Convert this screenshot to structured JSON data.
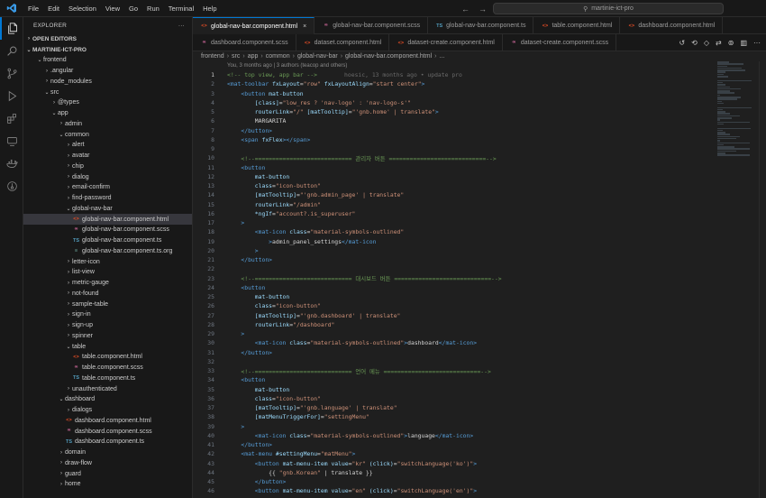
{
  "titlebar": {
    "menu": [
      "File",
      "Edit",
      "Selection",
      "View",
      "Go",
      "Run",
      "Terminal",
      "Help"
    ],
    "search": "martinie-ict-pro"
  },
  "sidebar": {
    "title": "EXPLORER",
    "open_editors": "OPEN EDITORS",
    "project": "MARTINIE-ICT-PRO",
    "tree": [
      {
        "label": "frontend",
        "depth": 1,
        "kind": "folder-open"
      },
      {
        "label": ".angular",
        "depth": 2,
        "kind": "folder"
      },
      {
        "label": "node_modules",
        "depth": 2,
        "kind": "folder"
      },
      {
        "label": "src",
        "depth": 2,
        "kind": "folder-open"
      },
      {
        "label": "@types",
        "depth": 3,
        "kind": "folder"
      },
      {
        "label": "app",
        "depth": 3,
        "kind": "folder-open"
      },
      {
        "label": "admin",
        "depth": 4,
        "kind": "folder"
      },
      {
        "label": "common",
        "depth": 4,
        "kind": "folder-open"
      },
      {
        "label": "alert",
        "depth": 5,
        "kind": "folder"
      },
      {
        "label": "avatar",
        "depth": 5,
        "kind": "folder"
      },
      {
        "label": "chip",
        "depth": 5,
        "kind": "folder"
      },
      {
        "label": "dialog",
        "depth": 5,
        "kind": "folder"
      },
      {
        "label": "email-confirm",
        "depth": 5,
        "kind": "folder"
      },
      {
        "label": "find-password",
        "depth": 5,
        "kind": "folder"
      },
      {
        "label": "global-nav-bar",
        "depth": 5,
        "kind": "folder-open"
      },
      {
        "label": "global-nav-bar.component.html",
        "depth": 6,
        "kind": "html",
        "selected": true
      },
      {
        "label": "global-nav-bar.component.scss",
        "depth": 6,
        "kind": "scss"
      },
      {
        "label": "global-nav-bar.component.ts",
        "depth": 6,
        "kind": "ts"
      },
      {
        "label": "global-nav-bar.component.ts.org",
        "depth": 6,
        "kind": "org"
      },
      {
        "label": "letter-icon",
        "depth": 5,
        "kind": "folder"
      },
      {
        "label": "list-view",
        "depth": 5,
        "kind": "folder"
      },
      {
        "label": "metric-gauge",
        "depth": 5,
        "kind": "folder"
      },
      {
        "label": "not-found",
        "depth": 5,
        "kind": "folder"
      },
      {
        "label": "sample-table",
        "depth": 5,
        "kind": "folder"
      },
      {
        "label": "sign-in",
        "depth": 5,
        "kind": "folder"
      },
      {
        "label": "sign-up",
        "depth": 5,
        "kind": "folder"
      },
      {
        "label": "spinner",
        "depth": 5,
        "kind": "folder"
      },
      {
        "label": "table",
        "depth": 5,
        "kind": "folder-open"
      },
      {
        "label": "table.component.html",
        "depth": 6,
        "kind": "html"
      },
      {
        "label": "table.component.scss",
        "depth": 6,
        "kind": "scss"
      },
      {
        "label": "table.component.ts",
        "depth": 6,
        "kind": "ts"
      },
      {
        "label": "unauthenticated",
        "depth": 5,
        "kind": "folder"
      },
      {
        "label": "dashboard",
        "depth": 4,
        "kind": "folder-open"
      },
      {
        "label": "dialogs",
        "depth": 5,
        "kind": "folder"
      },
      {
        "label": "dashboard.component.html",
        "depth": 5,
        "kind": "html"
      },
      {
        "label": "dashboard.component.scss",
        "depth": 5,
        "kind": "scss"
      },
      {
        "label": "dashboard.component.ts",
        "depth": 5,
        "kind": "ts"
      },
      {
        "label": "domain",
        "depth": 4,
        "kind": "folder"
      },
      {
        "label": "draw-flow",
        "depth": 4,
        "kind": "folder"
      },
      {
        "label": "guard",
        "depth": 4,
        "kind": "folder"
      },
      {
        "label": "home",
        "depth": 4,
        "kind": "folder"
      }
    ]
  },
  "tabs": {
    "row1": [
      {
        "label": "global-nav-bar.component.html",
        "kind": "html",
        "active": true
      },
      {
        "label": "global-nav-bar.component.scss",
        "kind": "scss"
      },
      {
        "label": "global-nav-bar.component.ts",
        "kind": "ts"
      },
      {
        "label": "table.component.html",
        "kind": "html"
      },
      {
        "label": "dashboard.component.html",
        "kind": "html"
      }
    ],
    "row2": [
      {
        "label": "dashboard.component.scss",
        "kind": "scss"
      },
      {
        "label": "dataset.component.html",
        "kind": "html"
      },
      {
        "label": "dataset-create.component.html",
        "kind": "html"
      },
      {
        "label": "dataset-create.component.scss",
        "kind": "scss"
      }
    ]
  },
  "breadcrumb": [
    "frontend",
    "src",
    "app",
    "common",
    "global-nav-bar",
    "global-nav-bar.component.html",
    "..."
  ],
  "editor": {
    "blame_header": "You, 3 months ago | 3 authors (teacop and others)",
    "inline_blame": "hoesic, 13 months ago • update pro",
    "lines": [
      [
        [
          "c",
          "<!-- top view, app bar -->"
        ]
      ],
      [
        [
          "t",
          "<mat-toolbar "
        ],
        [
          "a",
          "fxLayout"
        ],
        [
          "x",
          "="
        ],
        [
          "s",
          "\"row\""
        ],
        [
          "x",
          " "
        ],
        [
          "a",
          "fxLayoutAlign"
        ],
        [
          "x",
          "="
        ],
        [
          "s",
          "\"start center\""
        ],
        [
          "t",
          ">"
        ]
      ],
      [
        [
          "x",
          "    "
        ],
        [
          "t",
          "<button "
        ],
        [
          "a",
          "mat-button"
        ]
      ],
      [
        [
          "x",
          "        "
        ],
        [
          "a",
          "[class]"
        ],
        [
          "x",
          "="
        ],
        [
          "s",
          "\"low_res ? 'nav-logo' : 'nav-logo-s'\""
        ]
      ],
      [
        [
          "x",
          "        "
        ],
        [
          "a",
          "routerLink"
        ],
        [
          "x",
          "="
        ],
        [
          "s",
          "\"/\""
        ],
        [
          "x",
          " "
        ],
        [
          "a",
          "[matTooltip]"
        ],
        [
          "x",
          "="
        ],
        [
          "s",
          "\"'gnb.home' | translate\""
        ],
        [
          "t",
          ">"
        ]
      ],
      [
        [
          "x",
          "        MARGARITA"
        ]
      ],
      [
        [
          "x",
          "    "
        ],
        [
          "t",
          "</button>"
        ]
      ],
      [
        [
          "x",
          "    "
        ],
        [
          "t",
          "<span "
        ],
        [
          "a",
          "fxFlex"
        ],
        [
          "t",
          "></span>"
        ]
      ],
      [
        [
          "x",
          ""
        ]
      ],
      [
        [
          "x",
          "    "
        ],
        [
          "c",
          "<!--============================ 관리자 버튼 ============================-->"
        ]
      ],
      [
        [
          "x",
          "    "
        ],
        [
          "t",
          "<button"
        ]
      ],
      [
        [
          "x",
          "        "
        ],
        [
          "a",
          "mat-button"
        ]
      ],
      [
        [
          "x",
          "        "
        ],
        [
          "a",
          "class"
        ],
        [
          "x",
          "="
        ],
        [
          "s",
          "\"icon-button\""
        ]
      ],
      [
        [
          "x",
          "        "
        ],
        [
          "a",
          "[matTooltip]"
        ],
        [
          "x",
          "="
        ],
        [
          "s",
          "\"'gnb.admin_page' | translate\""
        ]
      ],
      [
        [
          "x",
          "        "
        ],
        [
          "a",
          "routerLink"
        ],
        [
          "x",
          "="
        ],
        [
          "s",
          "\"/admin\""
        ]
      ],
      [
        [
          "x",
          "        "
        ],
        [
          "a",
          "*ngIf"
        ],
        [
          "x",
          "="
        ],
        [
          "s",
          "\"account?.is_superuser\""
        ]
      ],
      [
        [
          "x",
          "    "
        ],
        [
          "t",
          ">"
        ]
      ],
      [
        [
          "x",
          "        "
        ],
        [
          "t",
          "<mat-icon "
        ],
        [
          "a",
          "class"
        ],
        [
          "x",
          "="
        ],
        [
          "s",
          "\"material-symbols-outlined\""
        ]
      ],
      [
        [
          "x",
          "            "
        ],
        [
          "t",
          ">"
        ],
        [
          "x",
          "admin_panel_settings"
        ],
        [
          "t",
          "</mat-icon"
        ]
      ],
      [
        [
          "x",
          "        "
        ],
        [
          "t",
          ">"
        ]
      ],
      [
        [
          "x",
          "    "
        ],
        [
          "t",
          "</button>"
        ]
      ],
      [
        [
          "x",
          ""
        ]
      ],
      [
        [
          "x",
          "    "
        ],
        [
          "c",
          "<!--============================ 대시보드 버튼 ============================-->"
        ]
      ],
      [
        [
          "x",
          "    "
        ],
        [
          "t",
          "<button"
        ]
      ],
      [
        [
          "x",
          "        "
        ],
        [
          "a",
          "mat-button"
        ]
      ],
      [
        [
          "x",
          "        "
        ],
        [
          "a",
          "class"
        ],
        [
          "x",
          "="
        ],
        [
          "s",
          "\"icon-button\""
        ]
      ],
      [
        [
          "x",
          "        "
        ],
        [
          "a",
          "[matTooltip]"
        ],
        [
          "x",
          "="
        ],
        [
          "s",
          "\"'gnb.dashboard' | translate\""
        ]
      ],
      [
        [
          "x",
          "        "
        ],
        [
          "a",
          "routerLink"
        ],
        [
          "x",
          "="
        ],
        [
          "s",
          "\"/dashboard\""
        ]
      ],
      [
        [
          "x",
          "    "
        ],
        [
          "t",
          ">"
        ]
      ],
      [
        [
          "x",
          "        "
        ],
        [
          "t",
          "<mat-icon "
        ],
        [
          "a",
          "class"
        ],
        [
          "x",
          "="
        ],
        [
          "s",
          "\"material-symbols-outlined\""
        ],
        [
          "t",
          ">"
        ],
        [
          "x",
          "dashboard"
        ],
        [
          "t",
          "</mat-icon>"
        ]
      ],
      [
        [
          "x",
          "    "
        ],
        [
          "t",
          "</button>"
        ]
      ],
      [
        [
          "x",
          ""
        ]
      ],
      [
        [
          "x",
          "    "
        ],
        [
          "c",
          "<!--============================ 언어 메뉴 ============================-->"
        ]
      ],
      [
        [
          "x",
          "    "
        ],
        [
          "t",
          "<button"
        ]
      ],
      [
        [
          "x",
          "        "
        ],
        [
          "a",
          "mat-button"
        ]
      ],
      [
        [
          "x",
          "        "
        ],
        [
          "a",
          "class"
        ],
        [
          "x",
          "="
        ],
        [
          "s",
          "\"icon-button\""
        ]
      ],
      [
        [
          "x",
          "        "
        ],
        [
          "a",
          "[matTooltip]"
        ],
        [
          "x",
          "="
        ],
        [
          "s",
          "\"'gnb.language' | translate\""
        ]
      ],
      [
        [
          "x",
          "        "
        ],
        [
          "a",
          "[matMenuTriggerFor]"
        ],
        [
          "x",
          "="
        ],
        [
          "s",
          "\"settingMenu\""
        ]
      ],
      [
        [
          "x",
          "    "
        ],
        [
          "t",
          ">"
        ]
      ],
      [
        [
          "x",
          "        "
        ],
        [
          "t",
          "<mat-icon "
        ],
        [
          "a",
          "class"
        ],
        [
          "x",
          "="
        ],
        [
          "s",
          "\"material-symbols-outlined\""
        ],
        [
          "t",
          ">"
        ],
        [
          "x",
          "language"
        ],
        [
          "t",
          "</mat-icon>"
        ]
      ],
      [
        [
          "x",
          "    "
        ],
        [
          "t",
          "</button>"
        ]
      ],
      [
        [
          "x",
          "    "
        ],
        [
          "t",
          "<mat-menu "
        ],
        [
          "a",
          "#settingMenu"
        ],
        [
          "x",
          "="
        ],
        [
          "s",
          "\"matMenu\""
        ],
        [
          "t",
          ">"
        ]
      ],
      [
        [
          "x",
          "        "
        ],
        [
          "t",
          "<button "
        ],
        [
          "a",
          "mat-menu-item "
        ],
        [
          "a",
          "value"
        ],
        [
          "x",
          "="
        ],
        [
          "s",
          "\"kr\""
        ],
        [
          "x",
          " "
        ],
        [
          "a",
          "(click)"
        ],
        [
          "x",
          "="
        ],
        [
          "s",
          "\"switchLanguage('ko')\""
        ],
        [
          "t",
          ">"
        ]
      ],
      [
        [
          "x",
          "            {{ "
        ],
        [
          "s",
          "\"gnb.Korean\""
        ],
        [
          "x",
          " | translate }}"
        ]
      ],
      [
        [
          "x",
          "        "
        ],
        [
          "t",
          "</button>"
        ]
      ],
      [
        [
          "x",
          "        "
        ],
        [
          "t",
          "<button "
        ],
        [
          "a",
          "mat-menu-item "
        ],
        [
          "a",
          "value"
        ],
        [
          "x",
          "="
        ],
        [
          "s",
          "\"en\""
        ],
        [
          "x",
          " "
        ],
        [
          "a",
          "(click)"
        ],
        [
          "x",
          "="
        ],
        [
          "s",
          "\"switchLanguage('en')\""
        ],
        [
          "t",
          ">"
        ]
      ]
    ]
  }
}
